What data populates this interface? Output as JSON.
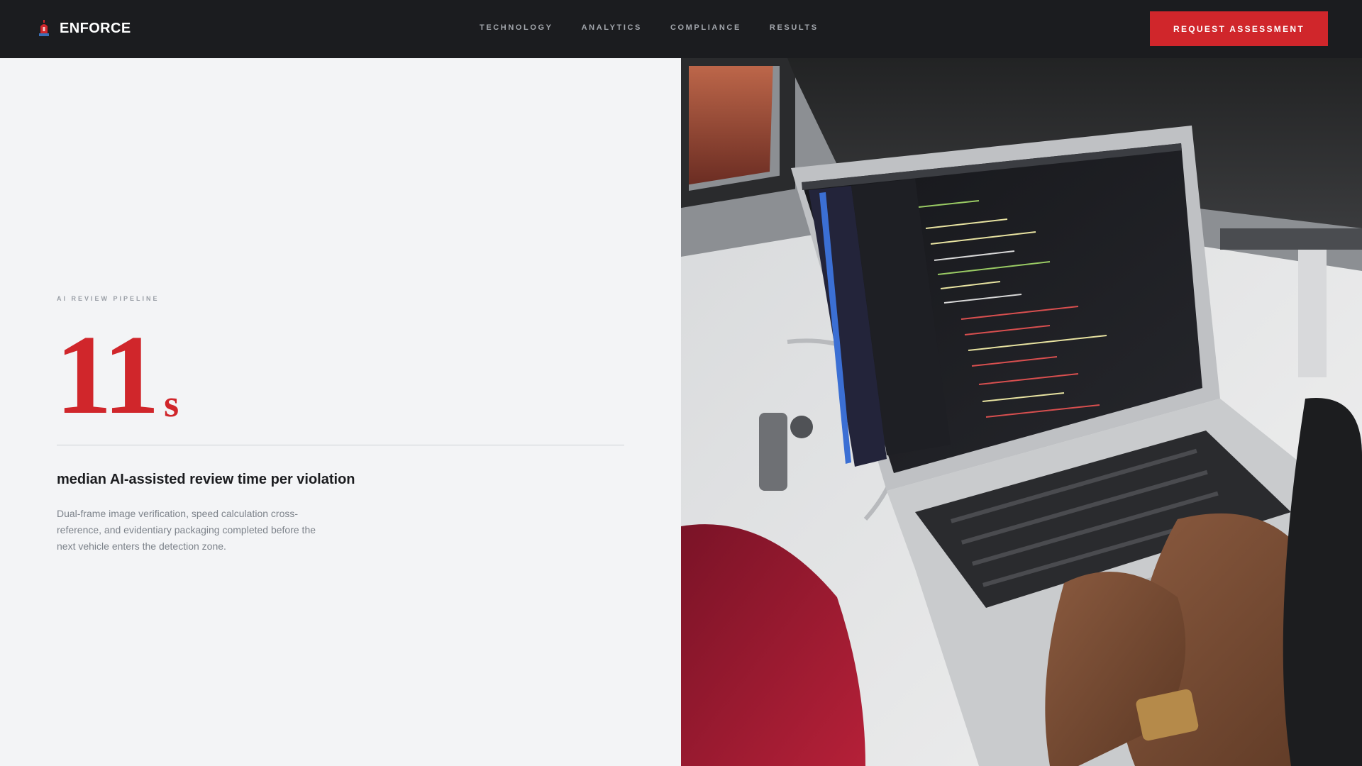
{
  "brand": {
    "name": "ENFORCE",
    "icon": "siren-icon"
  },
  "nav": {
    "links": [
      "TECHNOLOGY",
      "ANALYTICS",
      "COMPLIANCE",
      "RESULTS"
    ],
    "cta_label": "REQUEST ASSESSMENT"
  },
  "hero": {
    "eyebrow": "AI REVIEW PIPELINE",
    "stat_value": "11",
    "stat_unit": "s",
    "headline": "median AI-assisted review time per violation",
    "body": "Dual-frame image verification, speed calculation cross-reference, and evidentiary packaging completed before the next vehicle enters the detection zone."
  },
  "image": {
    "subject": "laptop-code-photo"
  },
  "colors": {
    "accent": "#d0262b",
    "nav_bg": "#1b1c1f",
    "page_bg": "#f3f4f6"
  }
}
